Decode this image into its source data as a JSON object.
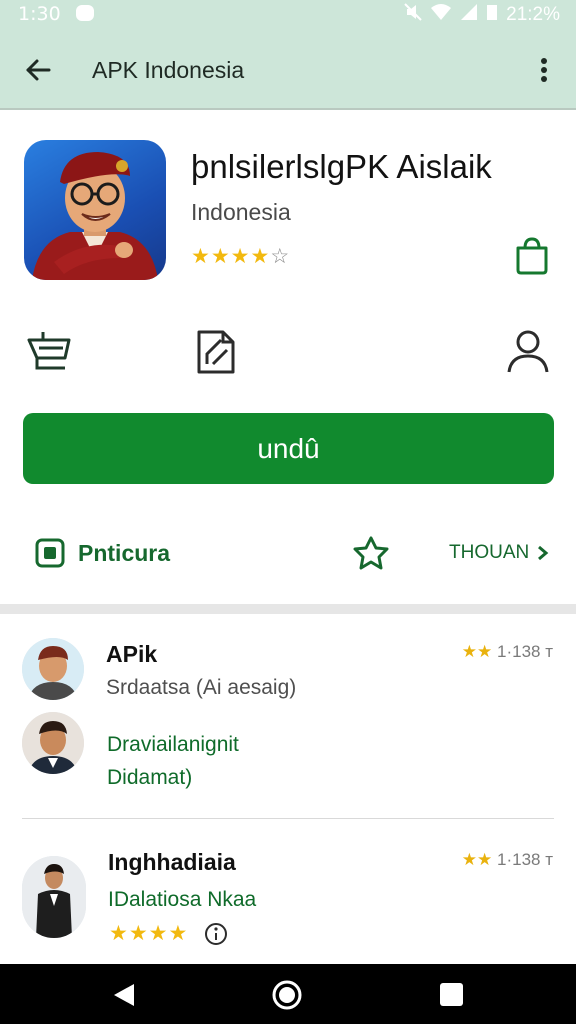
{
  "status_bar": {
    "time": "1:30",
    "clock_right": "21:2%"
  },
  "app_bar": {
    "title": "APK Indonesia",
    "back_icon": "arrow-left-icon",
    "menu_icon": "more-vert-icon"
  },
  "app": {
    "name": "þnlsilerlslgPK Aislaik",
    "developer": "Indonesia",
    "stars_filled": "★★★★",
    "stars_empty": "☆",
    "rating_value": 4,
    "rating_max": 5
  },
  "actions_row": {
    "icons": [
      "shopping-cart-icon",
      "document-edit-icon",
      "person-icon"
    ]
  },
  "install_button": {
    "label": "undû",
    "color": "#118a2e"
  },
  "links": {
    "left_label": "Pnticura",
    "right_label": "THOUAN"
  },
  "reviews": [
    {
      "name": "APik",
      "subtitle": "Srdaatsa (Ai aesaig)",
      "rating_stars": "★★",
      "rating_text": "1·138 т",
      "comment_line1": "Draviailanignit",
      "comment_line2": "Didamat)"
    },
    {
      "name": "Inghhadiaia",
      "subtitle": "IDalatiosa Nkaa",
      "rating_stars": "★★",
      "rating_text": "1·138 т",
      "stars": "★★★★"
    }
  ],
  "colors": {
    "accent": "#118a2e",
    "app_bar": "#cde6d9",
    "star": "#f2b90f",
    "link": "#16682e"
  }
}
